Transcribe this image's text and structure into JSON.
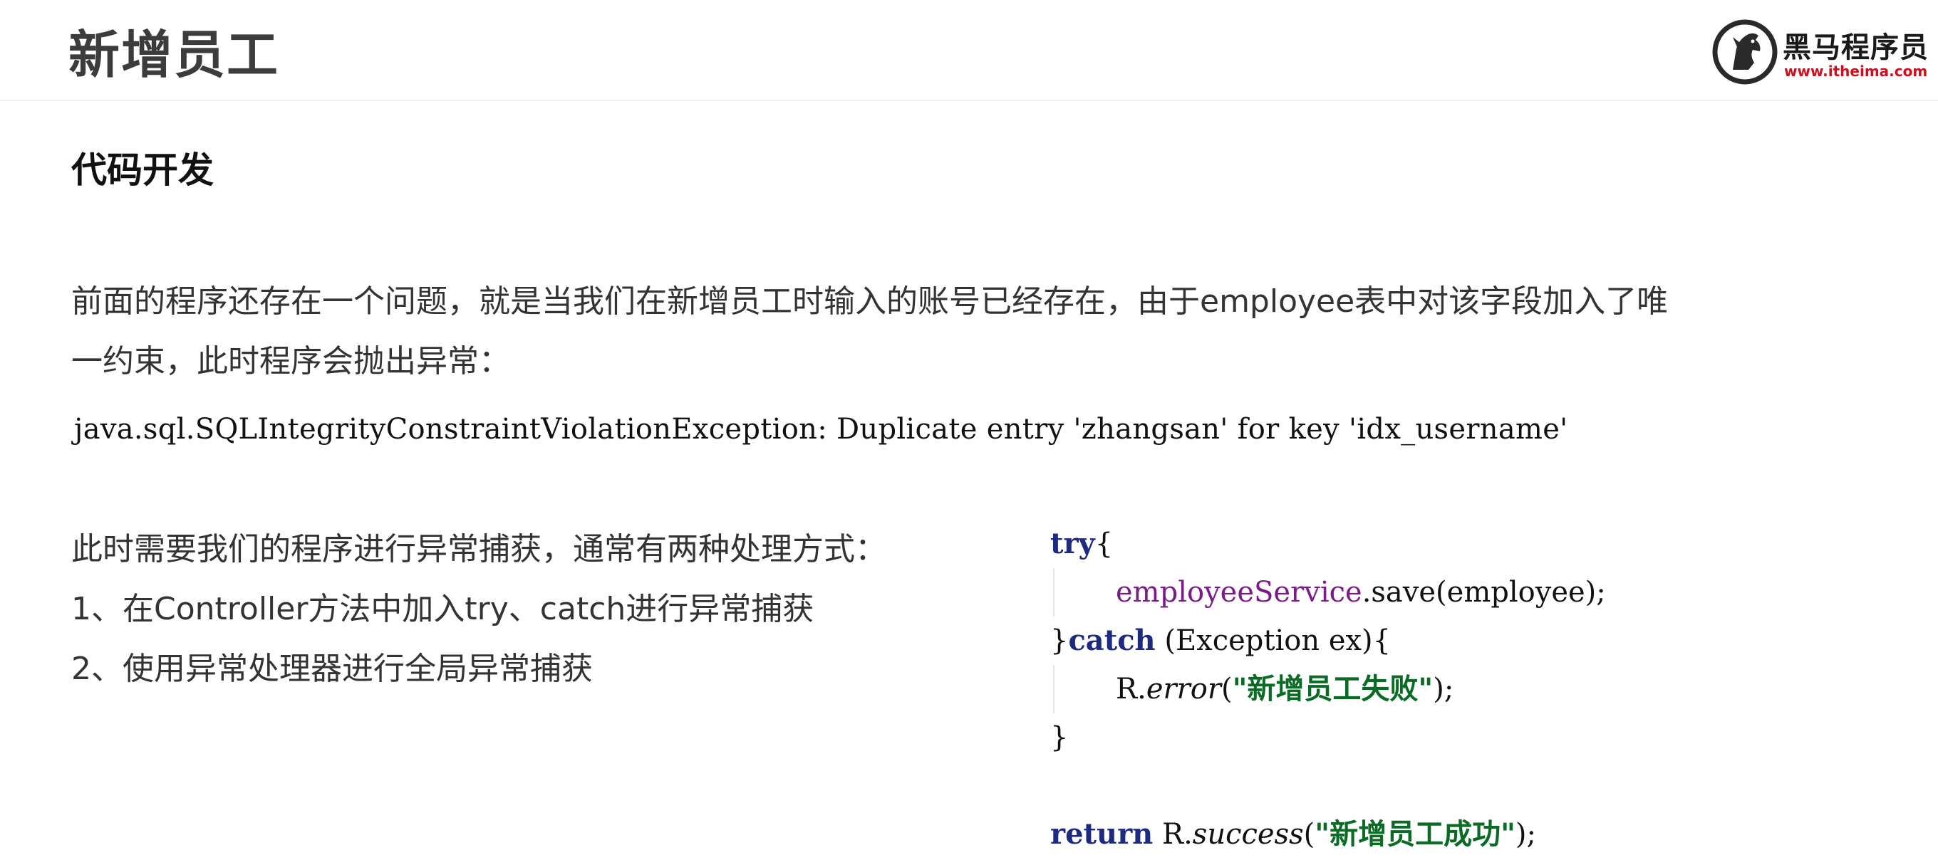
{
  "header": {
    "title": "新增员工",
    "logo": {
      "name": "黑马程序员",
      "url": "www.itheima.com",
      "icon": "horse-head-logo-icon",
      "colors": {
        "mark": "#2a2a2a",
        "url": "#c8101e"
      }
    }
  },
  "section": {
    "heading": "代码开发"
  },
  "paragraph": {
    "line1": "前面的程序还存在一个问题，就是当我们在新增员工时输入的账号已经存在，由于employee表中对该字段加入了唯",
    "line2": "一约束，此时程序会抛出异常："
  },
  "exception_text": "java.sql.SQLIntegrityConstraintViolationException: Duplicate entry 'zhangsan' for key 'idx_username'",
  "list": {
    "intro": "此时需要我们的程序进行异常捕获，通常有两种处理方式：",
    "item1": "1、在Controller方法中加入try、catch进行异常捕获",
    "item2": "2、使用异常处理器进行全局异常捕获"
  },
  "code": {
    "try_kw": "try",
    "open_brace": "{",
    "l2_field": "employeeService",
    "l2_rest": ".save(employee);",
    "close_brace": "}",
    "catch_kw": "catch",
    "l3_rest": " (Exception ex){",
    "l4_obj": "R.",
    "l4_method": "error",
    "l4_open": "(",
    "l4_str": "\"新增员工失败\"",
    "l4_close": ");",
    "l5": "}",
    "return_kw": "return",
    "l7_obj": " R.",
    "l7_method": "success",
    "l7_open": "(",
    "l7_str": "\"新增员工成功\"",
    "l7_close": ");",
    "colors": {
      "keyword": "#1d2a80",
      "field": "#7a1b87",
      "string": "#0a6b25"
    }
  }
}
